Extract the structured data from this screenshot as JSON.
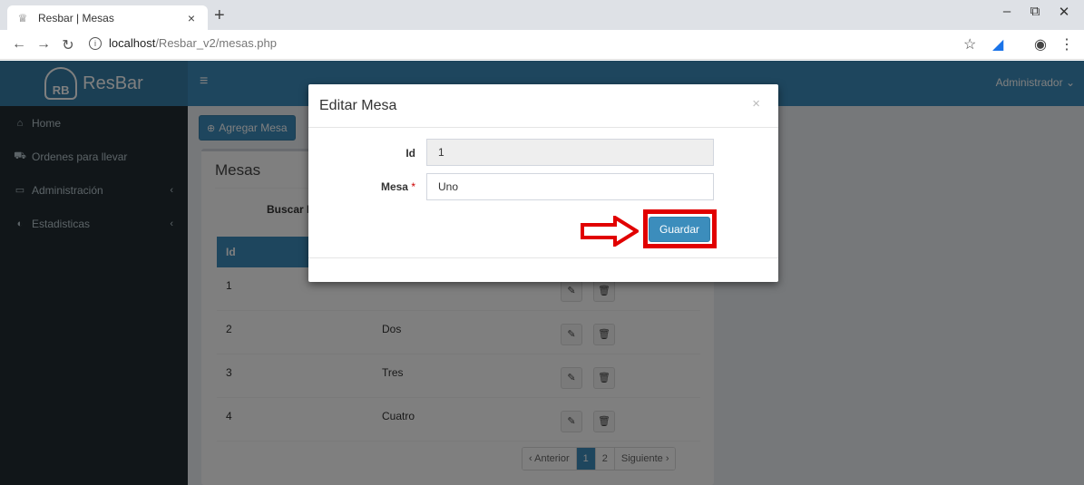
{
  "browser": {
    "tab_title": "Resbar | Mesas",
    "tab_close": "×",
    "new_tab": "+",
    "url_host": "localhost",
    "url_path": "/Resbar_v2/mesas.php",
    "win_minimize": "–",
    "win_restore": "⧉",
    "win_close": "✕"
  },
  "app": {
    "logo_mark": "RB",
    "logo_name": "ResBar",
    "menu_icon": "≡",
    "user_label": "Administrador ⌄"
  },
  "sidebar": {
    "items": [
      {
        "icon": "⌂",
        "label": "Home",
        "chevron": ""
      },
      {
        "icon": "⛟",
        "label": "Ordenes para llevar",
        "chevron": ""
      },
      {
        "icon": "▭",
        "label": "Administración",
        "chevron": "‹"
      },
      {
        "icon": "◐",
        "label": "Estadisticas",
        "chevron": "‹"
      }
    ]
  },
  "content": {
    "add_button": "Agregar Mesa",
    "box_title": "Mesas",
    "search_label": "Buscar M",
    "table_header_id": "Id",
    "rows": [
      {
        "id": "1",
        "mesa": ""
      },
      {
        "id": "2",
        "mesa": "Dos"
      },
      {
        "id": "3",
        "mesa": "Tres"
      },
      {
        "id": "4",
        "mesa": "Cuatro"
      }
    ],
    "pager": {
      "prev": "‹ Anterior",
      "p1": "1",
      "p2": "2",
      "next": "Siguiente ›"
    }
  },
  "modal": {
    "title": "Editar Mesa",
    "close": "×",
    "id_label": "Id",
    "id_value": "1",
    "mesa_label": "Mesa",
    "required_mark": "*",
    "mesa_value": "Uno",
    "save_label": "Guardar"
  },
  "colors": {
    "primary": "#3c8dbc",
    "sidebar": "#222d32",
    "highlight": "#e10000"
  }
}
